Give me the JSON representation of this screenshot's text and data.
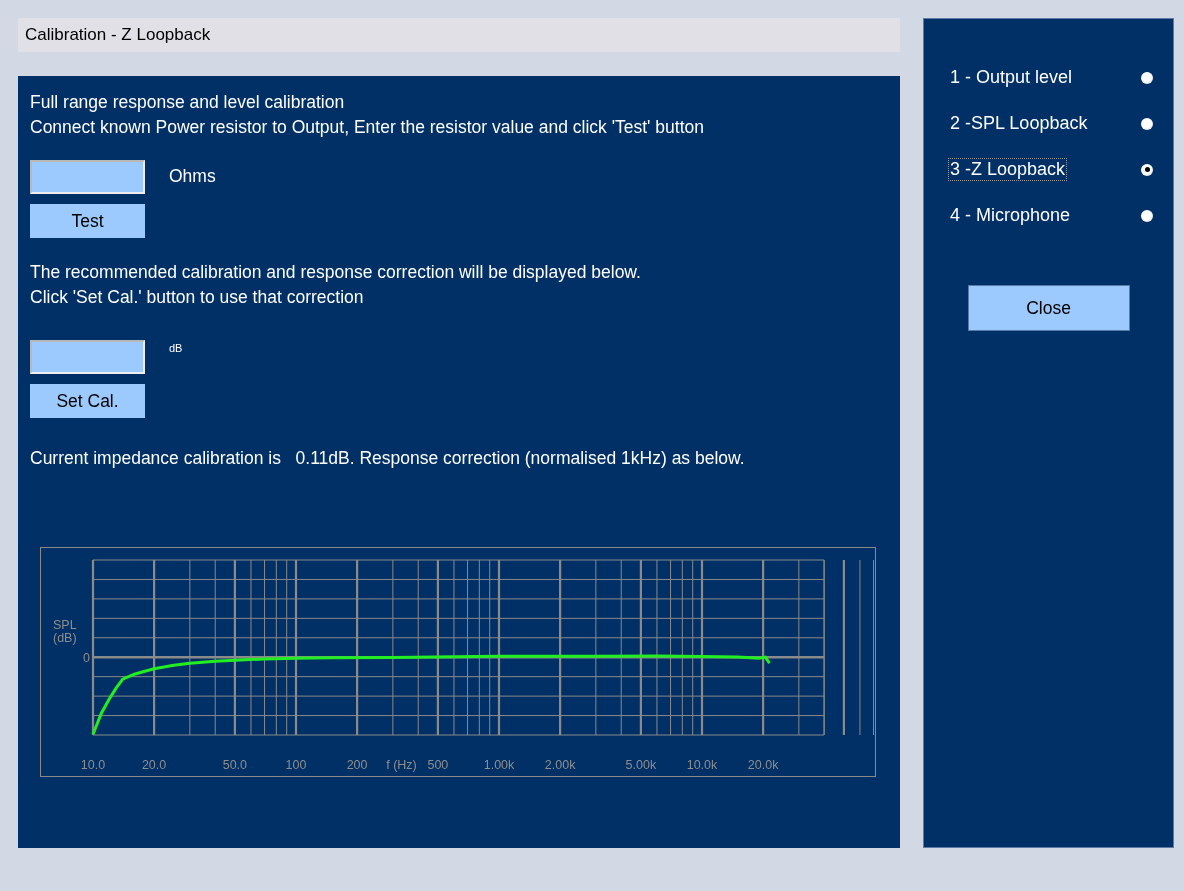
{
  "window": {
    "title": "Calibration - Z Loopback"
  },
  "main": {
    "intro_lines": [
      "Full range response and level calibration",
      "Connect known Power resistor to Output, Enter the resistor value and click 'Test' button"
    ],
    "resistor_field": {
      "unit": "Ohms"
    },
    "test_button": "Test",
    "info_lines": [
      "The recommended calibration and response correction will be displayed below.",
      "Click 'Set Cal.' button to use that correction"
    ],
    "cal_field": {
      "unit": "dB"
    },
    "set_cal_button": "Set Cal.",
    "status": "Current impedance calibration is   0.11dB. Response correction (normalised 1kHz) as below.",
    "chart": {
      "ylabel": [
        "SPL",
        "(dB)"
      ],
      "y_tick": "0",
      "xlabel": "f (Hz)",
      "x_tick_labels": [
        "10.0",
        "20.0",
        "50.0",
        "100",
        "200",
        "500",
        "1.00k",
        "2.00k",
        "5.00k",
        "10.0k",
        "20.0k"
      ]
    }
  },
  "modes": [
    {
      "label": "1 - Output level",
      "selected": false,
      "focused": false
    },
    {
      "label": "2 -SPL Loopback",
      "selected": false,
      "focused": false
    },
    {
      "label": "3 -Z Loopback",
      "selected": true,
      "focused": true
    },
    {
      "label": "4 - Microphone",
      "selected": false,
      "focused": false
    }
  ],
  "close_button": "Close"
}
